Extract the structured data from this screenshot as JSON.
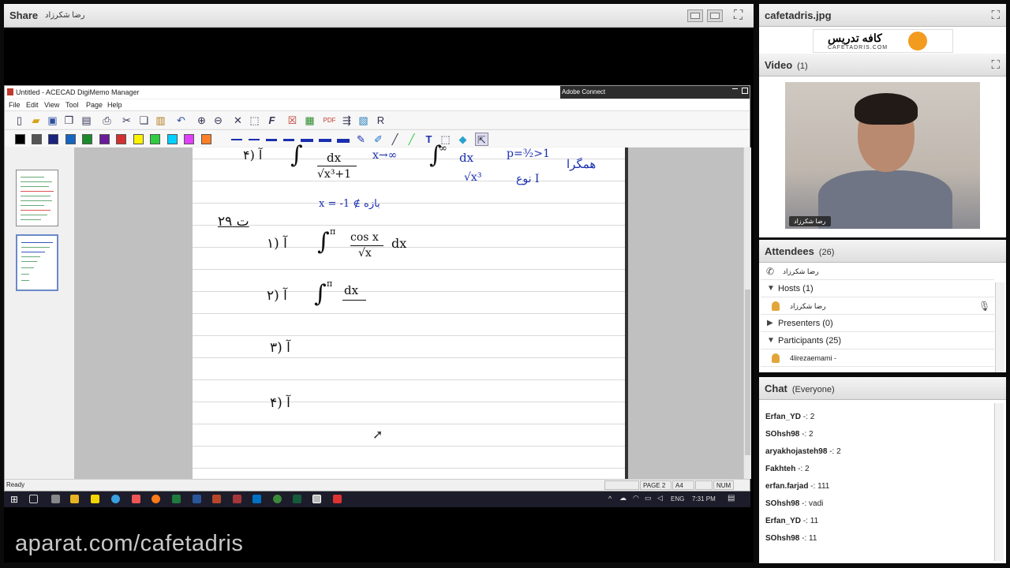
{
  "share_pod": {
    "title": "Share",
    "presenter": "رضا شکرزاد",
    "watermark": "aparat.com/cafetadris"
  },
  "ace_window": {
    "title": "Untitled - ACECAD DigiMemo Manager",
    "overlay": "Adobe Connect",
    "menu": [
      "File",
      "Edit",
      "View",
      "Tool",
      "Page",
      "Help"
    ],
    "toolbar_icons": [
      "new-page-icon",
      "open-icon",
      "save-icon",
      "copy-page-icon",
      "pages-icon",
      "print-icon",
      "cut-icon",
      "copy-icon",
      "paste-icon",
      "undo-icon",
      "zoom-in-icon",
      "zoom-out-icon",
      "delete-icon",
      "select-icon",
      "font-icon",
      "close-doc-icon",
      "convert-icon",
      "pdf-icon",
      "export-icon",
      "image-icon",
      "recognize-icon"
    ],
    "colors": [
      "#000000",
      "#555555",
      "#1a237e",
      "#1565c0",
      "#1b8a2a",
      "#6a1b9a",
      "#d32f2f",
      "#fff200",
      "#2ecc40",
      "#00d0ff",
      "#e040fb",
      "#ff7f27"
    ],
    "tools": [
      "pen-icon",
      "highlighter-icon",
      "line-icon",
      "marker-icon",
      "text-icon",
      "select-area-icon",
      "eraser-icon",
      "pointer-icon"
    ],
    "status": {
      "left": "Ready",
      "page": "PAGE 2",
      "size": "A4",
      "num": "NUM"
    },
    "notes": {
      "n1": "۴) آ",
      "n2": "dx",
      "n3": "√x³+1",
      "n4": "x→∞",
      "n5": "∞",
      "n6": "dx",
      "n7": "√x³",
      "n8": "p=³⁄₂>1",
      "n9": "نوع I",
      "n10": "همگرا",
      "n11": "x = -1 ∉ بازه",
      "n12": "ت ۲۹",
      "n13": "۱) آ",
      "n14": "π",
      "n15": "cos x",
      "n16": "√x",
      "n17": "dx",
      "n18": "۲) آ",
      "n19": "π",
      "n20": "dx",
      "n21": "۳) آ",
      "n22": "۴) آ"
    }
  },
  "taskbar": {
    "lang": "ENG",
    "time": "7:31 PM"
  },
  "file_pod": {
    "title": "cafetadris.jpg",
    "logo_text": "کافه تدریس",
    "logo_url": "CAFETADRIS.COM"
  },
  "video_pod": {
    "title": "Video",
    "count": "(1)",
    "name_tag": "رضا شکرزاد"
  },
  "attendees_pod": {
    "title": "Attendees",
    "count": "(26)",
    "me": "رضا شکرزاد",
    "hosts_label": "Hosts (1)",
    "host_name": "رضا شکرزاد",
    "presenters_label": "Presenters (0)",
    "participants_label": "Participants (25)",
    "participant_1": "4lirezaemami -"
  },
  "chat_pod": {
    "title": "Chat",
    "scope": "(Everyone)",
    "messages": [
      {
        "user": "Erfan_YD",
        "text": "2"
      },
      {
        "user": "SOhsh98",
        "text": "2"
      },
      {
        "user": "aryakhojasteh98",
        "text": "2"
      },
      {
        "user": "Fakhteh",
        "text": "2"
      },
      {
        "user": "erfan.farjad",
        "text": "111"
      },
      {
        "user": "SOhsh98",
        "text": "vadi"
      },
      {
        "user": "Erfan_YD",
        "text": "11"
      },
      {
        "user": "SOhsh98",
        "text": "11"
      }
    ]
  }
}
